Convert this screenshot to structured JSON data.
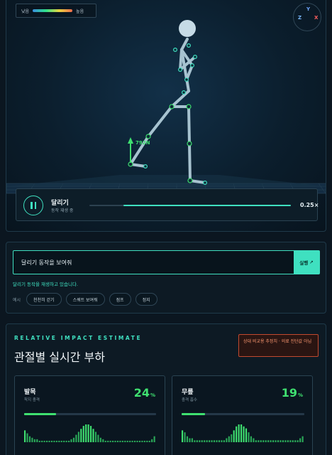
{
  "legend": {
    "low": "낮음",
    "high": "높음"
  },
  "gizmo": {
    "y": "Y",
    "z": "Z",
    "x": "X"
  },
  "force_label": "792N",
  "playback": {
    "title": "달리기",
    "status": "동작 재생 중",
    "speed": "0.25×",
    "progress": 0.83
  },
  "prompt": {
    "input_value": "달리기 동작을 보여줘",
    "run_label": "실행",
    "status": "달리기 동작을 재생하고 있습니다.",
    "examples_label": "예시",
    "examples": [
      "천천히 걷기",
      "스쿼트 보여줘",
      "점프",
      "정지"
    ]
  },
  "impact": {
    "eyebrow": "RELATIVE IMPACT ESTIMATE",
    "title": "관절별 실시간 부하",
    "disclaimer": "상대 비교용 추정치 · 의료 진단값 아님",
    "joints": [
      {
        "name": "발목",
        "sub": "착지 충격",
        "percent": "24",
        "unit": "%",
        "level": 0.24,
        "history": [
          8,
          6,
          4,
          3,
          2,
          2,
          1,
          1,
          1,
          1,
          1,
          1,
          1,
          1,
          1,
          1,
          1,
          1,
          1,
          2,
          3,
          5,
          7,
          9,
          11,
          12,
          12,
          11,
          9,
          7,
          5,
          3,
          2,
          1,
          1,
          1,
          1,
          1,
          1,
          1,
          1,
          1,
          1,
          1,
          1,
          1,
          1,
          1,
          1,
          1,
          1,
          1,
          2,
          4
        ]
      },
      {
        "name": "무릎",
        "sub": "충격 흡수",
        "percent": "19",
        "unit": "%",
        "level": 0.19,
        "history": [
          6,
          5,
          3,
          2,
          2,
          1,
          1,
          1,
          1,
          1,
          1,
          1,
          1,
          1,
          1,
          1,
          1,
          1,
          2,
          3,
          4,
          6,
          8,
          9,
          9,
          8,
          7,
          5,
          3,
          2,
          1,
          1,
          1,
          1,
          1,
          1,
          1,
          1,
          1,
          1,
          1,
          1,
          1,
          1,
          1,
          1,
          1,
          1,
          2,
          3
        ]
      }
    ]
  }
}
